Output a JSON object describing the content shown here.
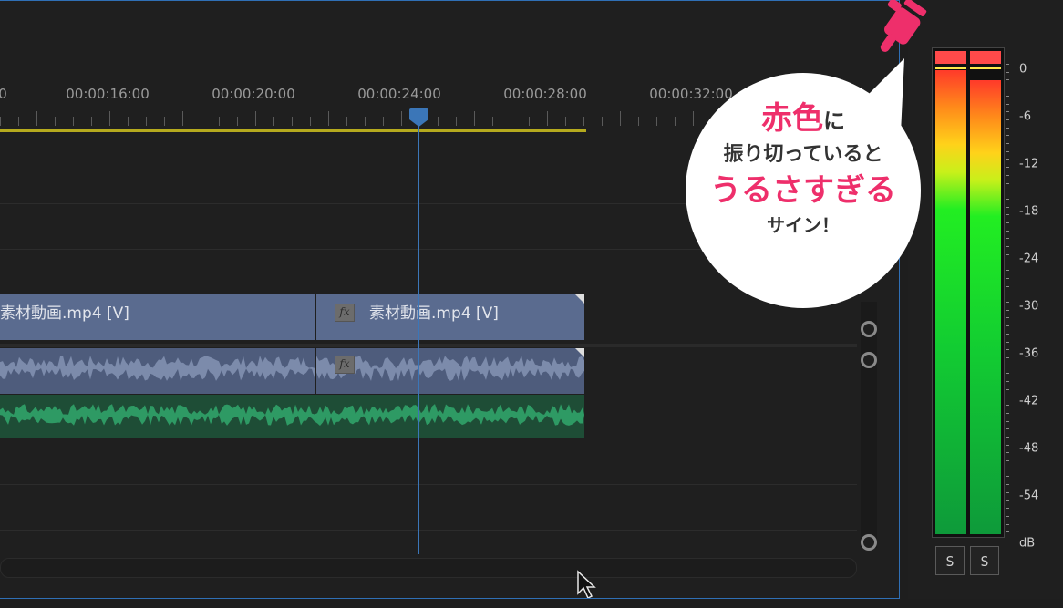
{
  "timeline": {
    "timecodes": [
      "0",
      "00:00:16:00",
      "00:00:20:00",
      "00:00:24:00",
      "00:00:28:00",
      "00:00:32:00"
    ],
    "video_clips": [
      {
        "label": "素材動画.mp4 [V]"
      },
      {
        "label": "素材動画.mp4 [V]"
      }
    ],
    "fx_label": "fx",
    "playhead_timecode_index": 3
  },
  "meter": {
    "db_labels": [
      "0",
      "-6",
      "-12",
      "-18",
      "-24",
      "-30",
      "-36",
      "-42",
      "-48",
      "-54",
      "dB"
    ],
    "solo_buttons": [
      "S",
      "S"
    ],
    "left_level_fraction": 0.96,
    "right_level_fraction": 0.94,
    "clip_indicator_color": "#ff4a4a"
  },
  "callout": {
    "line1_red": "赤色",
    "line1_rest": "に",
    "line2": "振り切っていると",
    "line3_red": "うるさすぎる",
    "line4": "サイン！"
  },
  "colors": {
    "accent_red": "#ee2f6b",
    "playhead_blue": "#3b76b8",
    "video_clip": "#5a6b8f",
    "audio_clip": "#4e5c7c",
    "audio_green": "#2e9a64",
    "work_area": "#b5aa1e"
  },
  "icons": {
    "hand": "pointing-hand-icon",
    "cursor": "mouse-cursor-icon"
  }
}
